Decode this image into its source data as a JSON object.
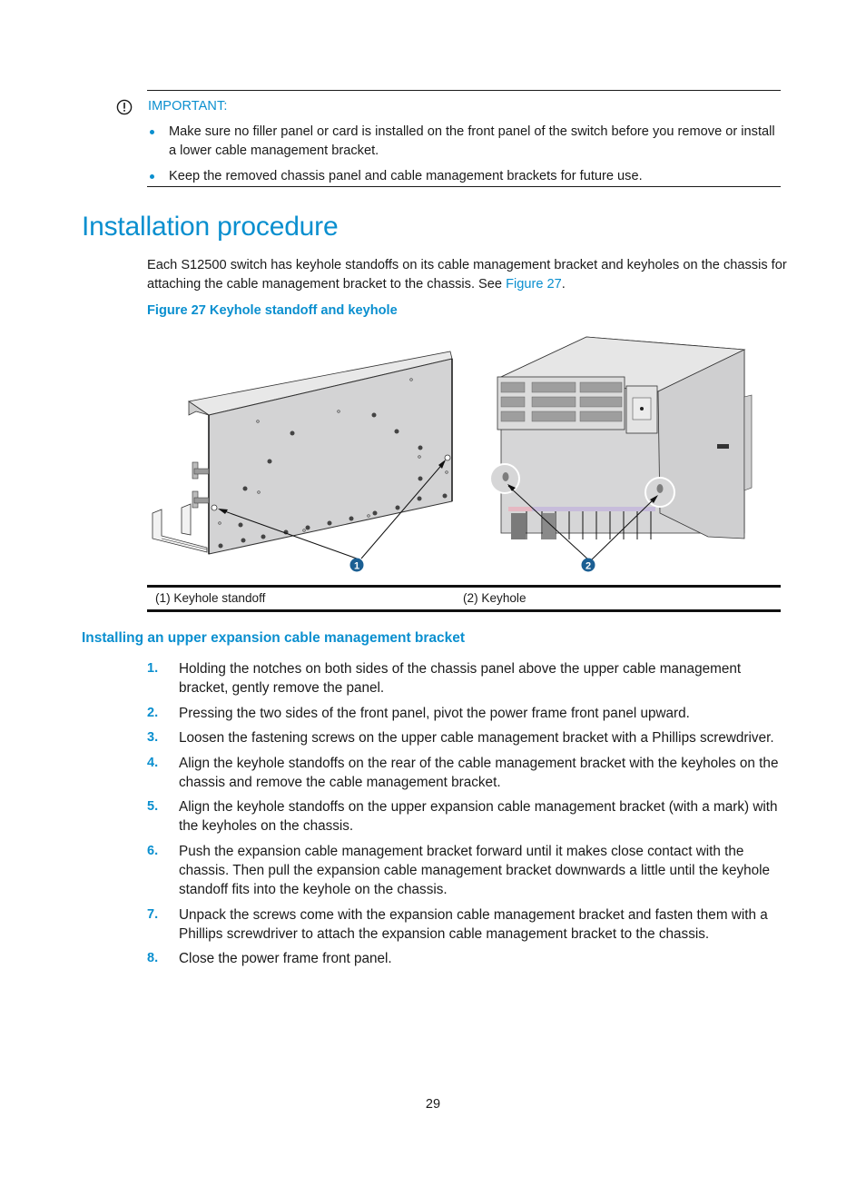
{
  "important": {
    "icon": "exclamation-circle-icon",
    "label": "IMPORTANT:",
    "bullets": [
      "Make sure no filler panel or card is installed on the front panel of the switch before you remove or install a lower cable management bracket.",
      "Keep the removed chassis panel and cable management brackets for future use."
    ]
  },
  "section": {
    "title": "Installation procedure",
    "intro_before_link": "Each S12500 switch has keyhole standoffs on its cable management bracket and keyholes on the chassis for attaching the cable management bracket to the chassis. See ",
    "intro_link": "Figure 27",
    "intro_after_link": "."
  },
  "figure": {
    "caption": "Figure 27 Keyhole standoff and keyhole",
    "callouts": [
      "1",
      "2"
    ],
    "legend": [
      "(1) Keyhole standoff",
      "(2) Keyhole"
    ]
  },
  "subsection": {
    "title": "Installing an upper expansion cable management bracket",
    "steps": [
      {
        "num": "1.",
        "text": "Holding the notches on both sides of the chassis panel above the upper cable management bracket, gently remove the panel."
      },
      {
        "num": "2.",
        "text": "Pressing the two sides of the front panel, pivot the power frame front panel upward."
      },
      {
        "num": "3.",
        "text": "Loosen the fastening screws on the upper cable management bracket with a Phillips screwdriver."
      },
      {
        "num": "4.",
        "text": "Align the keyhole standoffs on the rear of the cable management bracket with the keyholes on the chassis and remove the cable management bracket."
      },
      {
        "num": "5.",
        "text": "Align the keyhole standoffs on the upper expansion cable management bracket (with a mark) with the keyholes on the chassis."
      },
      {
        "num": "6.",
        "text": "Push the expansion cable management bracket forward until it makes close contact with the chassis. Then pull the expansion cable management bracket downwards a little until the keyhole standoff fits into the keyhole on the chassis."
      },
      {
        "num": "7.",
        "text": "Unpack the screws come with the expansion cable management bracket and fasten them with a Phillips screwdriver to attach the expansion cable management bracket to the chassis."
      },
      {
        "num": "8.",
        "text": "Close the power frame front panel."
      }
    ]
  },
  "page_number": "29",
  "colors": {
    "accent": "#0a8fcf",
    "callout": "#1b5f93",
    "text": "#1a1a1a"
  }
}
